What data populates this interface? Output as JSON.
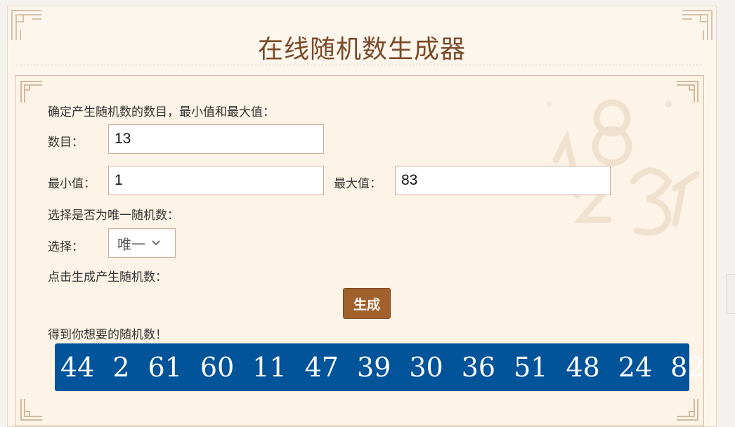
{
  "title": "在线随机数生成器",
  "form": {
    "intro": "确定产生随机数的数目，最小值和最大值：",
    "count_label": "数目：",
    "count_value": "13",
    "min_label": "最小值：",
    "min_value": "1",
    "max_label": "最大值：",
    "max_value": "83",
    "unique_intro": "选择是否为唯一随机数：",
    "select_label": "选择：",
    "select_value": "唯一",
    "generate_intro": "点击生成产生随机数：",
    "generate_button": "生成",
    "result_intro": "得到你想要的随机数！"
  },
  "result_numbers": [
    "44",
    "2",
    "61",
    "60",
    "11",
    "47",
    "39",
    "30",
    "36",
    "51",
    "48",
    "24",
    "82"
  ],
  "colors": {
    "title": "#7a4a2b",
    "button": "#a0612d",
    "result_bg": "#01539a"
  },
  "icons": [
    "corner-ornament-icon",
    "chevron-down-icon"
  ]
}
